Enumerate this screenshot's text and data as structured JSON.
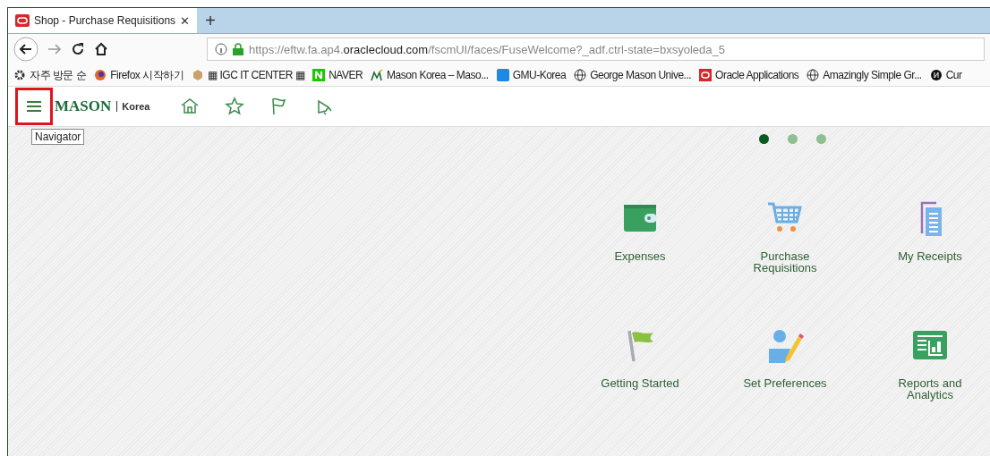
{
  "browser": {
    "tabs": [
      {
        "title": "Shop - Purchase Requisitions",
        "selected": true,
        "close": "✕"
      }
    ],
    "new_tab": "+",
    "url": {
      "prefix": "https://eftw.fa.ap4.",
      "domain": "oraclecloud.com",
      "path": "/fscmUI/faces/FuseWelcome?_adf.ctrl-state=bxsyoleda_5"
    },
    "bookmarks": [
      {
        "label": "자주 방문 순",
        "kind": "gear"
      },
      {
        "label": "Firefox 시작하기",
        "kind": "firefox"
      },
      {
        "label": "▦ IGC IT CENTER ▦",
        "kind": "box"
      },
      {
        "label": "NAVER",
        "kind": "naver"
      },
      {
        "label": "Mason Korea – Maso...",
        "kind": "mason"
      },
      {
        "label": "GMU-Korea",
        "kind": "gsm"
      },
      {
        "label": "George Mason Unive...",
        "kind": "globe"
      },
      {
        "label": "Oracle Applications",
        "kind": "oracle"
      },
      {
        "label": "Amazingly Simple Gr...",
        "kind": "globe"
      },
      {
        "label": "Cur",
        "kind": "n"
      }
    ]
  },
  "app": {
    "logo": {
      "name": "MASON",
      "suffix": "Korea"
    },
    "navigator_highlighted": true,
    "tooltip": "Navigator",
    "page_dots": [
      {
        "selected": true
      },
      {
        "selected": false
      },
      {
        "selected": false
      }
    ],
    "tiles": [
      {
        "label": "Expenses",
        "kind": "wallet"
      },
      {
        "label": "Purchase Requisitions",
        "kind": "cart"
      },
      {
        "label": "My Receipts",
        "kind": "receipts"
      },
      {
        "label": "Getting Started",
        "kind": "flag"
      },
      {
        "label": "Set Preferences",
        "kind": "person"
      },
      {
        "label": "Reports and Analytics",
        "kind": "report"
      }
    ]
  }
}
